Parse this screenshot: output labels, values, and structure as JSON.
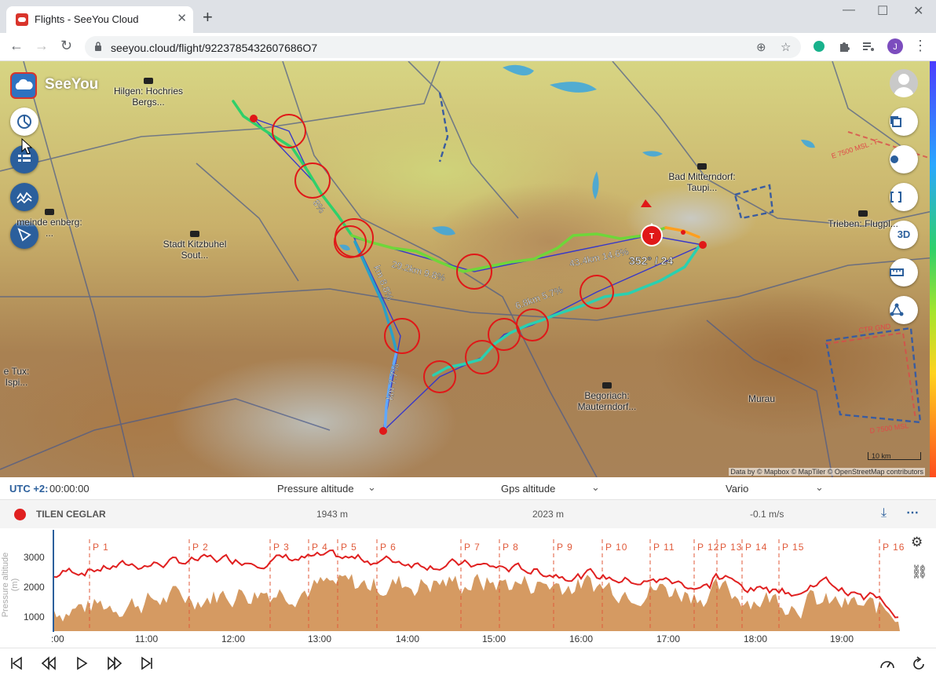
{
  "browser": {
    "tab_title": "Flights - SeeYou Cloud",
    "url": "seeyou.cloud/flight/9223785432607686O7",
    "minimize": "—",
    "maximize": "☐",
    "close": "✕",
    "new_tab": "+"
  },
  "app": {
    "name": "SeeYou"
  },
  "map": {
    "places": [
      {
        "label": "Hilgen: Hochries Bergs..."
      },
      {
        "label": "Bad Mitterndorf: Taupi..."
      },
      {
        "label": "Trieben: Flugpl..."
      },
      {
        "label": "Stadt Kitzbuhel Sout..."
      },
      {
        "label": "meinde enberg: ..."
      },
      {
        "label": "e Tux: Ispi..."
      },
      {
        "label": "Begoriach: Mauterndorf..."
      },
      {
        "label": "Murau"
      }
    ],
    "leg_labels": [
      "29.2km 9.8%",
      "43.4km 14.6%",
      "6.8km 5.7%",
      "km 8.8%",
      "km 7.7%",
      "8%"
    ],
    "heading_readout": "352° / 24",
    "airspace_labels": [
      "E 7500 MSL - F",
      "CTR GND",
      "D 7500 MSL"
    ],
    "attribution": "Data by © Mapbox © MapTiler © OpenStreetMap contributors",
    "scale_label": "10 km",
    "right_buttons": [
      "copy",
      "locate",
      "fullscreen",
      "3D",
      "ruler",
      "share"
    ],
    "btn_3d": "3D"
  },
  "panel": {
    "utc_label": "UTC +2:",
    "utc_time": "00:00:00",
    "selector1": "Pressure altitude",
    "selector2": "Gps altitude",
    "selector3": "Vario",
    "pilot": "TILEN CEGLAR",
    "pressure_alt": "1943 m",
    "gps_alt": "2023 m",
    "vario": "-0.1 m/s"
  },
  "graph": {
    "ylabel": "Pressure altitude (m)",
    "yticks": [
      "3000",
      "2000",
      "1000"
    ],
    "xticks": [
      ":00",
      "11:00",
      "12:00",
      "13:00",
      "14:00",
      "15:00",
      "16:00",
      "17:00",
      "18:00",
      "19:00"
    ],
    "points": [
      "P 1",
      "P 2",
      "P 3",
      "P 4",
      "P 5",
      "P 6",
      "P 7",
      "P 8",
      "P 9",
      "P 10",
      "P 11",
      "P 12",
      "P 13",
      "P 14",
      "P 15",
      "P 16"
    ],
    "colors": {
      "flight": "#e02020",
      "terrain": "#d59a62",
      "points": "#e05a3a"
    }
  }
}
